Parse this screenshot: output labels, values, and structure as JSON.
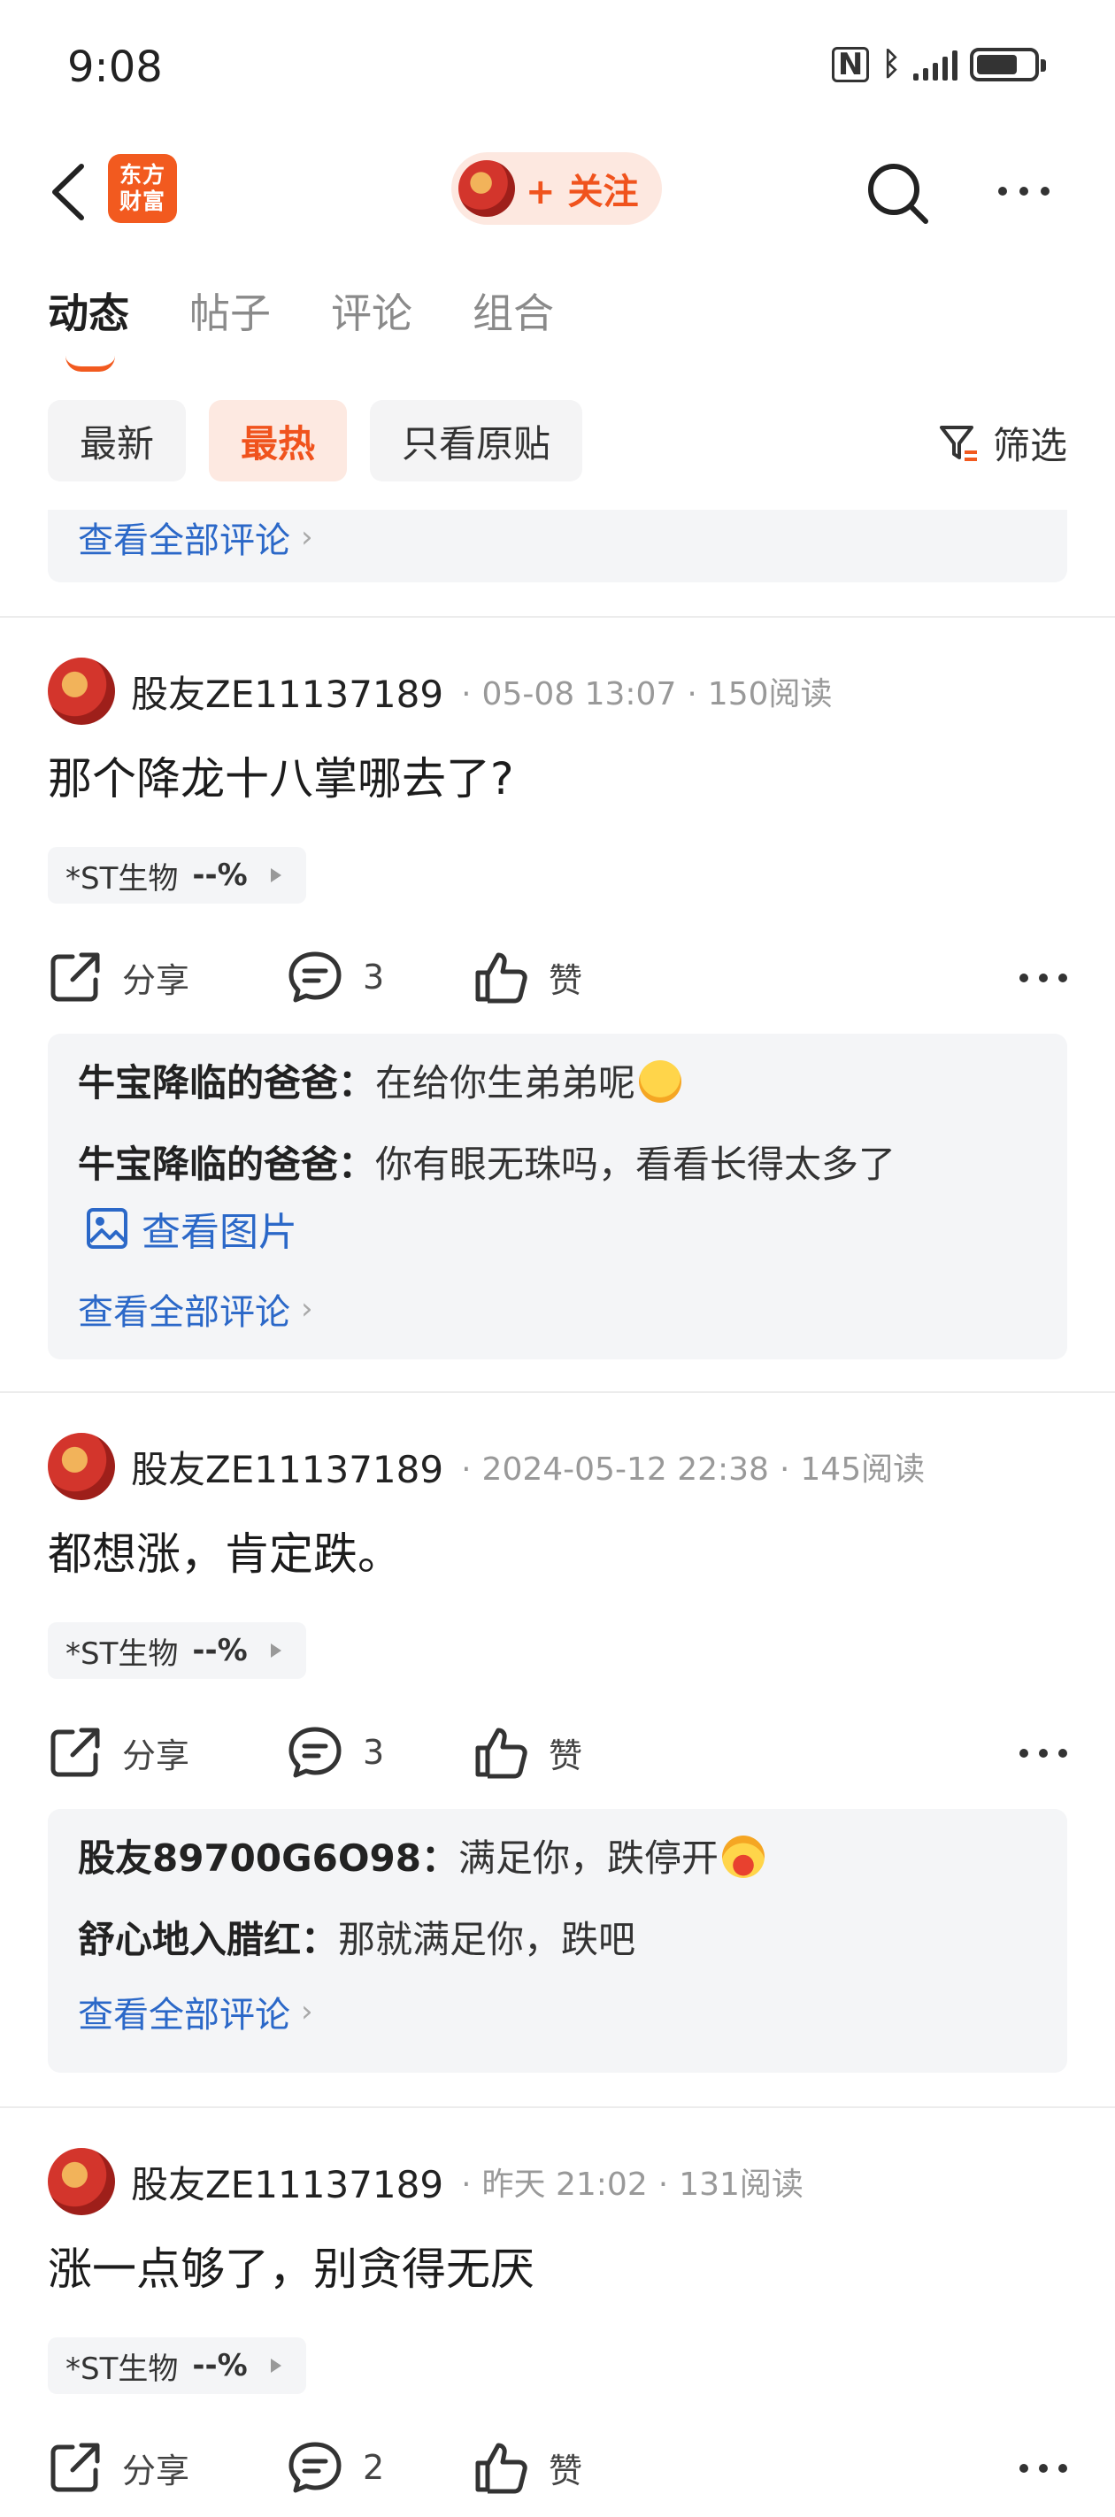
{
  "status_bar": {
    "time": "9:08"
  },
  "nav": {
    "logo_line1": "东方",
    "logo_line2": "财富",
    "follow_label": "+ 关注"
  },
  "tabs": [
    {
      "label": "动态"
    },
    {
      "label": "帖子"
    },
    {
      "label": "评论"
    },
    {
      "label": "组合"
    }
  ],
  "filters": {
    "items": [
      {
        "label": "最新"
      },
      {
        "label": "最热"
      },
      {
        "label": "只看原贴"
      }
    ],
    "screen_label": "筛选"
  },
  "view_all_label": "查看全部评论",
  "actions": {
    "share_label": "分享",
    "like_label": "赞"
  },
  "colors": {
    "accent": "#f25a1f",
    "link": "#2b68c8"
  },
  "posts": [
    {
      "author": "股友ZE11137189",
      "date": "05-08 13:07",
      "reads": "150阅读",
      "content": "那个降龙十八掌哪去了?",
      "stock_name": "*ST生物",
      "stock_pct": "--%",
      "comment_count": "3",
      "comments": [
        {
          "user": "牛宝降临的爸爸",
          "text": "在给你生弟弟呢"
        },
        {
          "user": "牛宝降临的爸爸",
          "text": "你有眼无珠吗，看看长得太多了"
        }
      ],
      "image_link": "查看图片"
    },
    {
      "author": "股友ZE11137189",
      "date": "2024-05-12 22:38",
      "reads": "145阅读",
      "content": "都想涨，肯定跌。",
      "stock_name": "*ST生物",
      "stock_pct": "--%",
      "comment_count": "3",
      "comments": [
        {
          "user": "股友89700G6O98",
          "text": "满足你，跌停开"
        },
        {
          "user": "舒心地入腊红",
          "text": "那就满足你，跌吧"
        }
      ]
    },
    {
      "author": "股友ZE11137189",
      "date": "昨天 21:02",
      "reads": "131阅读",
      "content": "涨一点够了，别贪得无厌",
      "stock_name": "*ST生物",
      "stock_pct": "--%",
      "comment_count": "2"
    }
  ]
}
